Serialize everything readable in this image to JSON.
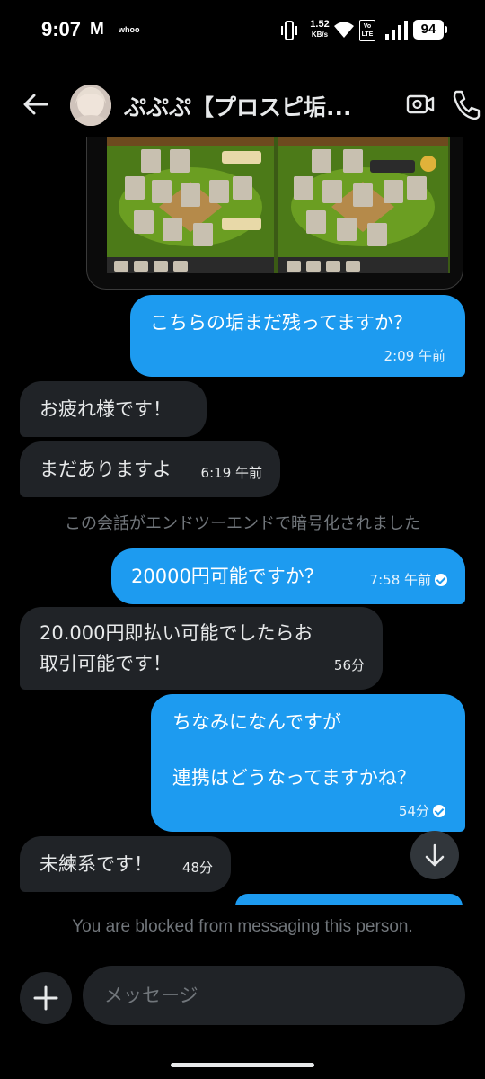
{
  "status_bar": {
    "time": "9:07",
    "gmail_icon": "gmail-icon",
    "app_label": "whoo",
    "net_speed_value": "1.52",
    "net_speed_unit": "KB/s",
    "volte_top": "Vo",
    "volte_bottom": "LTE",
    "battery": "94"
  },
  "header": {
    "contact_name": "ぷぷぷ【プロスピ垢...",
    "icons": [
      "back-arrow-icon",
      "video-call-icon",
      "phone-call-icon"
    ]
  },
  "conversation": {
    "shared_image_icon": "game-screenshot-image",
    "messages": [
      {
        "direction": "out",
        "text": "こちらの垢まだ残ってますか？",
        "time": "2:09 午前"
      },
      {
        "direction": "in",
        "text": "お疲れ様です！",
        "time": ""
      },
      {
        "direction": "in",
        "text": "まだありますよ",
        "time": "6:19 午前"
      },
      {
        "direction": "out",
        "text": "20000円可能ですか？",
        "time": "7:58 午前",
        "read": true
      },
      {
        "direction": "in",
        "text_line1": "20.000円即払い可能でしたらお",
        "text_line2": "取引可能です！",
        "time": "56分"
      },
      {
        "direction": "out",
        "text_line1": "ちなみになんですが",
        "text_line2": "連携はどうなってますかね？",
        "time": "54分",
        "read": true
      },
      {
        "direction": "in",
        "text": "未練系です！",
        "time": "48分"
      }
    ],
    "system_note": "この会話がエンドツーエンドで暗号化されました"
  },
  "footer": {
    "blocked_notice": "You are blocked from messaging this person.",
    "input_placeholder": "メッセージ"
  },
  "colors": {
    "background": "#000000",
    "outgoing_bubble": "#1d9bf0",
    "incoming_bubble": "#202327",
    "muted_text": "#71767b"
  }
}
